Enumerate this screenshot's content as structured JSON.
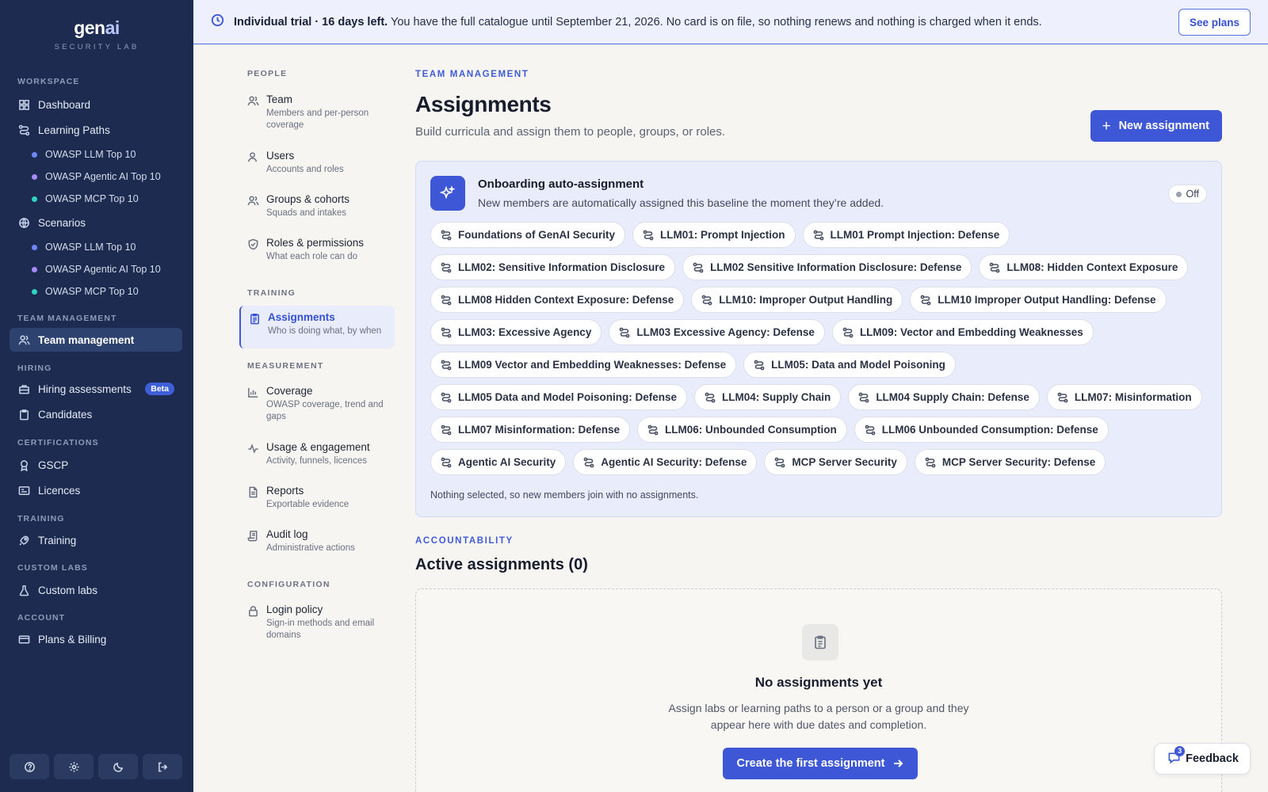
{
  "brand": {
    "name_main": "gen",
    "name_accent": "ai",
    "subtitle": "SECURITY LAB"
  },
  "sidebar": {
    "workspace_label": "WORKSPACE",
    "dashboard": "Dashboard",
    "learning_paths": "Learning Paths",
    "learning_paths_items": [
      "OWASP LLM Top 10",
      "OWASP Agentic AI Top 10",
      "OWASP MCP Top 10"
    ],
    "scenarios": "Scenarios",
    "scenarios_items": [
      "OWASP LLM Top 10",
      "OWASP Agentic AI Top 10",
      "OWASP MCP Top 10"
    ],
    "team_label": "TEAM MANAGEMENT",
    "team_management": "Team management",
    "hiring_label": "HIRING",
    "hiring_assessments": "Hiring assessments",
    "beta": "Beta",
    "candidates": "Candidates",
    "certs_label": "CERTIFICATIONS",
    "gscp": "GSCP",
    "licences": "Licences",
    "training_label": "TRAINING",
    "training": "Training",
    "custom_labs_label": "CUSTOM LABS",
    "custom_labs": "Custom labs",
    "account_label": "ACCOUNT",
    "plans_billing": "Plans & Billing"
  },
  "dot_colors": {
    "llm": "#6f86ff",
    "agentic": "#a78bfa",
    "mcp": "#2dd4bf"
  },
  "banner": {
    "bold": "Individual trial · 16 days left.",
    "text": "You have the full catalogue until September 21, 2026. No card is on file, so nothing renews and nothing is charged when it ends.",
    "button": "See plans"
  },
  "subnav": {
    "people_label": "PEOPLE",
    "training_label": "TRAINING",
    "measurement_label": "MEASUREMENT",
    "configuration_label": "CONFIGURATION",
    "team": {
      "title": "Team",
      "desc": "Members and per-person coverage"
    },
    "users": {
      "title": "Users",
      "desc": "Accounts and roles"
    },
    "groups": {
      "title": "Groups & cohorts",
      "desc": "Squads and intakes"
    },
    "roles": {
      "title": "Roles & permissions",
      "desc": "What each role can do"
    },
    "assignments": {
      "title": "Assignments",
      "desc": "Who is doing what, by when"
    },
    "coverage": {
      "title": "Coverage",
      "desc": "OWASP coverage, trend and gaps"
    },
    "usage": {
      "title": "Usage & engagement",
      "desc": "Activity, funnels, licences"
    },
    "reports": {
      "title": "Reports",
      "desc": "Exportable evidence"
    },
    "audit": {
      "title": "Audit log",
      "desc": "Administrative actions"
    },
    "login": {
      "title": "Login policy",
      "desc": "Sign-in methods and email domains"
    }
  },
  "main": {
    "eyebrow": "TEAM MANAGEMENT",
    "title": "Assignments",
    "subtitle": "Build curricula and assign them to people, groups, or roles.",
    "new_button": "New assignment",
    "auto": {
      "title": "Onboarding auto-assignment",
      "desc": "New members are automatically assigned this baseline the moment they’re added.",
      "toggle": "Off",
      "chips": [
        "Foundations of GenAI Security",
        "LLM01: Prompt Injection",
        "LLM01 Prompt Injection: Defense",
        "LLM02: Sensitive Information Disclosure",
        "LLM02 Sensitive Information Disclosure: Defense",
        "LLM08: Hidden Context Exposure",
        "LLM08 Hidden Context Exposure: Defense",
        "LLM10: Improper Output Handling",
        "LLM10 Improper Output Handling: Defense",
        "LLM03: Excessive Agency",
        "LLM03 Excessive Agency: Defense",
        "LLM09: Vector and Embedding Weaknesses",
        "LLM09 Vector and Embedding Weaknesses: Defense",
        "LLM05: Data and Model Poisoning",
        "LLM05 Data and Model Poisoning: Defense",
        "LLM04: Supply Chain",
        "LLM04 Supply Chain: Defense",
        "LLM07: Misinformation",
        "LLM07 Misinformation: Defense",
        "LLM06: Unbounded Consumption",
        "LLM06 Unbounded Consumption: Defense",
        "Agentic AI Security",
        "Agentic AI Security: Defense",
        "MCP Server Security",
        "MCP Server Security: Defense"
      ],
      "note": "Nothing selected, so new members join with no assignments."
    },
    "accountability_eyebrow": "ACCOUNTABILITY",
    "active_title": "Active assignments (0)",
    "empty": {
      "title": "No assignments yet",
      "desc": "Assign labs or learning paths to a person or a group and they appear here with due dates and completion.",
      "button": "Create the first assignment"
    }
  },
  "feedback": {
    "label": "Feedback",
    "count": "3"
  }
}
